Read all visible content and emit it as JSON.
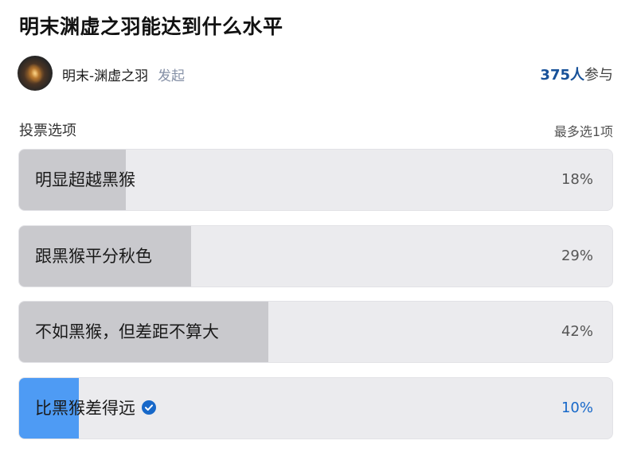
{
  "poll": {
    "title": "明末渊虚之羽能达到什么水平",
    "author": {
      "name": "明末-渊虚之羽",
      "action": "发起"
    },
    "participants": {
      "count": "375人",
      "suffix": "参与"
    },
    "options_label": "投票选项",
    "max_select": "最多选1项",
    "options": [
      {
        "label": "明显超越黑猴",
        "percent_text": "18%",
        "percent": 18,
        "selected": false
      },
      {
        "label": "跟黑猴平分秋色",
        "percent_text": "29%",
        "percent": 29,
        "selected": false
      },
      {
        "label": "不如黑猴，但差距不算大",
        "percent_text": "42%",
        "percent": 42,
        "selected": false
      },
      {
        "label": "比黑猴差得远",
        "percent_text": "10%",
        "percent": 10,
        "selected": true
      }
    ]
  },
  "colors": {
    "accent": "#1768c9",
    "selected_fill": "#4e9bf4",
    "result_fill": "#c9c9cd",
    "option_bg": "#ebebee"
  }
}
